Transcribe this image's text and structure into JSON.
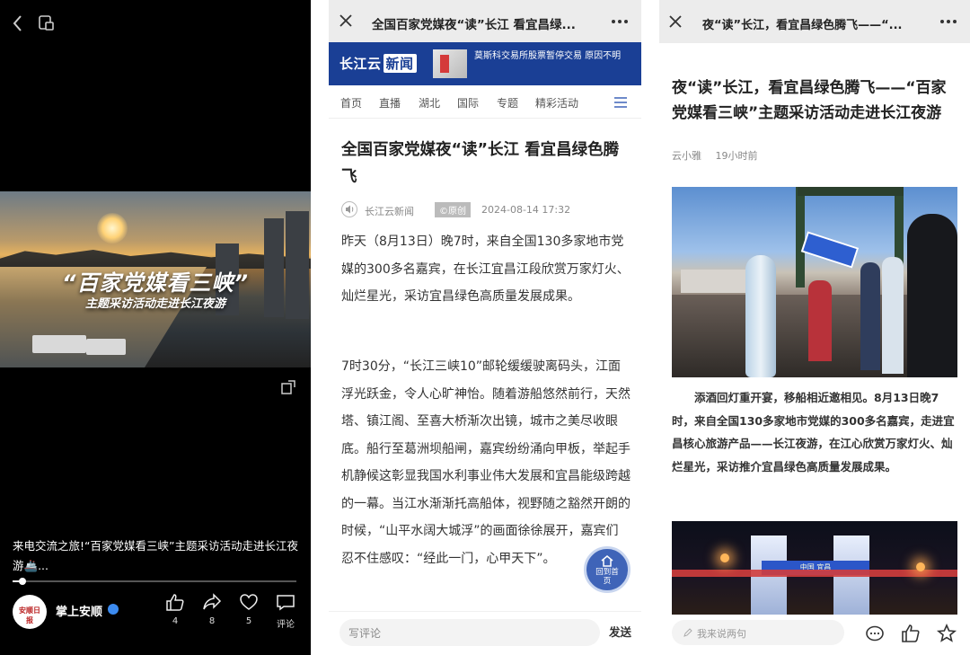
{
  "video_panel": {
    "overlay_title": "“百家党媒看三峡”",
    "overlay_subtitle": "主题采访活动走进长江夜游",
    "caption": "来电交流之旅!“百家党媒看三峡”主题采访活动走进长江夜游🚢...",
    "progress": 0.03,
    "author": {
      "name": "掌上安顺",
      "avatar_text": "安顺日报"
    },
    "actions": [
      {
        "icon": "thumbs-up-icon",
        "label": "4"
      },
      {
        "icon": "share-icon",
        "label": "8"
      },
      {
        "icon": "heart-icon",
        "label": "5"
      },
      {
        "icon": "comment-icon",
        "label": "评论"
      }
    ]
  },
  "article_panel": {
    "top_title": "全国百家党媒夜“读”长江 看宜昌绿...",
    "banner": {
      "logo": "长江云",
      "logo_tag": "新闻",
      "ticker": "莫斯科交易所股票暂停交易 原因不明"
    },
    "nav": [
      "首页",
      "直播",
      "湖北",
      "国际",
      "专题",
      "精彩活动"
    ],
    "title": "全国百家党媒夜“读”长江 看宜昌绿色腾飞",
    "source": "长江云新闻",
    "badge": "©原创",
    "time": "2024-08-14 17:32",
    "paragraphs": [
      "昨天（8月13日）晚7时，来自全国130多家地市党媒的300多名嘉宾，在长江宜昌江段欣赏万家灯火、灿烂星光，采访宜昌绿色高质量发展成果。",
      "7时30分，“长江三峡10”邮轮缓缓驶离码头，江面浮光跃金，令人心旷神怡。随着游船悠然前行，天然塔、镇江阁、至喜大桥渐次出镜，城市之美尽收眼底。船行至葛洲坝船闸，嘉宾纷纷涌向甲板，举起手机静候这彰显我国水利事业伟大发展和宜昌能级跨越的一幕。当江水渐渐托高船体，视野随之豁然开朗的时候，“山平水阔大城浮”的画面徐徐展开，嘉宾们忍不住感叹：“经此一门，心甲天下”。"
    ],
    "float_button": "回到首页",
    "comment_placeholder": "写评论",
    "send_label": "发送"
  },
  "story_panel": {
    "top_title": "夜“读”长江，看宜昌绿色腾飞——“...",
    "title": "夜“读”长江，看宜昌绿色腾飞——“百家党媒看三峡”主题采访活动走进长江夜游",
    "author": "云小雅",
    "time": "19小时前",
    "caption": "添酒回灯重开宴，移船相近邀相见。8月13日晚7时，来自全国130多家地市党媒的300多名嘉宾，走进宜昌核心旅游产品——长江夜游，在江心欣赏万家灯火、灿烂星光，采访推介宜昌绿色高质量发展成果。",
    "photo2_sign": "中国 宜昌",
    "comment_placeholder": "我来说两句"
  },
  "colors": {
    "brand_blue": "#1a3f95",
    "float_blue": "#3f64b8",
    "verified_blue": "#3c8bf0"
  }
}
